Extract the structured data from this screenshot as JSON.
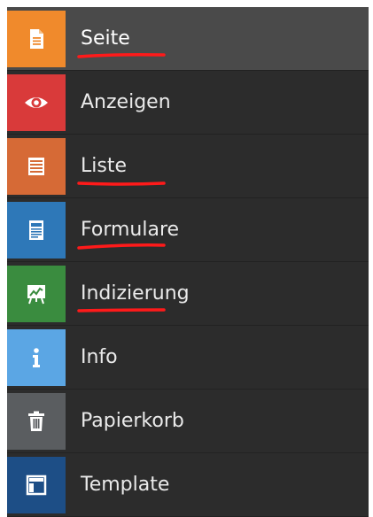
{
  "menu": {
    "items": [
      {
        "label": "Seite",
        "icon": "document-icon",
        "color": "#f08a2c",
        "active": true,
        "underlined": true
      },
      {
        "label": "Anzeigen",
        "icon": "eye-icon",
        "color": "#d93a3a",
        "active": false,
        "underlined": false
      },
      {
        "label": "Liste",
        "icon": "list-icon",
        "color": "#d66a36",
        "active": false,
        "underlined": true
      },
      {
        "label": "Formulare",
        "icon": "form-icon",
        "color": "#2e78b8",
        "active": false,
        "underlined": true
      },
      {
        "label": "Indizierung",
        "icon": "presentation-chart-icon",
        "color": "#3a8c3f",
        "active": false,
        "underlined": true
      },
      {
        "label": "Info",
        "icon": "info-icon",
        "color": "#5ba6e4",
        "active": false,
        "underlined": false
      },
      {
        "label": "Papierkorb",
        "icon": "trash-icon",
        "color": "#5a5d60",
        "active": false,
        "underlined": false
      },
      {
        "label": "Template",
        "icon": "layout-template-icon",
        "color": "#1d4e86",
        "active": false,
        "underlined": false
      }
    ]
  },
  "annotation_color": "#ff1a1a"
}
